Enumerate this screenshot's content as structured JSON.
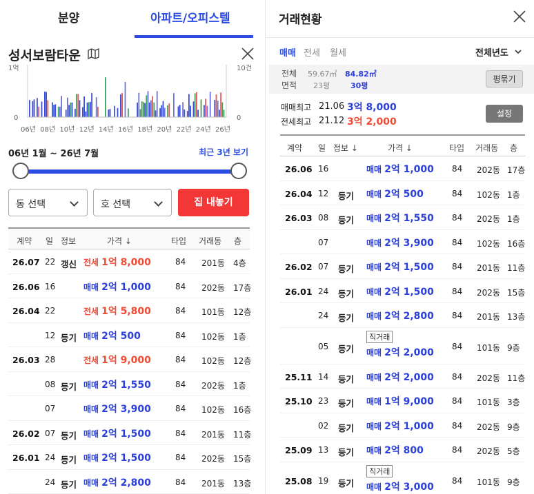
{
  "tabs": [
    {
      "label": "분양"
    },
    {
      "label": "아파트/오피스텔"
    }
  ],
  "apt": {
    "name": "성서보람타운"
  },
  "chart_data": {
    "type": "bar",
    "x_ticks": [
      "06년",
      "08년",
      "10년",
      "12년",
      "14년",
      "16년",
      "18년",
      "20년",
      "22년",
      "24년",
      "26년"
    ],
    "y_left_top": "1억",
    "y_left_bottom": "0",
    "y_right_top": "10건",
    "y_right_bottom": "0"
  },
  "period": {
    "label": "06년 1월 ~ 26년 7월",
    "recent": "최근 3년 보기"
  },
  "filters": {
    "dong": "동 선택",
    "ho": "호 선택",
    "sell": "집 내놓기"
  },
  "left_table": {
    "headers": [
      "계약",
      "일",
      "정보",
      "가격 ↓",
      "타입",
      "거래동",
      "층"
    ],
    "rows": [
      {
        "date": "26.07",
        "day": "22",
        "info": "갱신",
        "kind": "전세",
        "price": "1억 8,000",
        "type": "84",
        "dong": "201동",
        "floor": "4층",
        "rent": true
      },
      {
        "date": "26.06",
        "day": "16",
        "info": "",
        "kind": "매매",
        "price": "2억 1,000",
        "type": "84",
        "dong": "202동",
        "floor": "17층",
        "rent": false
      },
      {
        "date": "26.04",
        "day": "22",
        "info": "",
        "kind": "전세",
        "price": "1억 5,800",
        "type": "84",
        "dong": "101동",
        "floor": "12층",
        "rent": true
      },
      {
        "date": "",
        "day": "12",
        "info": "등기",
        "kind": "매매",
        "price": "2억 500",
        "type": "84",
        "dong": "102동",
        "floor": "1층",
        "rent": false
      },
      {
        "date": "26.03",
        "day": "28",
        "info": "",
        "kind": "전세",
        "price": "1억 9,000",
        "type": "84",
        "dong": "102동",
        "floor": "12층",
        "rent": true
      },
      {
        "date": "",
        "day": "08",
        "info": "등기",
        "kind": "매매",
        "price": "2억 1,550",
        "type": "84",
        "dong": "202동",
        "floor": "1층",
        "rent": false
      },
      {
        "date": "",
        "day": "07",
        "info": "",
        "kind": "매매",
        "price": "2억 3,900",
        "type": "84",
        "dong": "102동",
        "floor": "16층",
        "rent": false
      },
      {
        "date": "26.02",
        "day": "07",
        "info": "등기",
        "kind": "매매",
        "price": "2억 1,500",
        "type": "84",
        "dong": "201동",
        "floor": "11층",
        "rent": false
      },
      {
        "date": "26.01",
        "day": "24",
        "info": "등기",
        "kind": "매매",
        "price": "2억 1,500",
        "type": "84",
        "dong": "202동",
        "floor": "15층",
        "rent": false
      },
      {
        "date": "",
        "day": "24",
        "info": "등기",
        "kind": "매매",
        "price": "2억 2,800",
        "type": "84",
        "dong": "201동",
        "floor": "13층",
        "rent": false
      }
    ]
  },
  "right": {
    "title": "거래현황",
    "subtabs": [
      "매매",
      "전세",
      "월세"
    ],
    "year": "전체년도",
    "area": {
      "label1": "전체",
      "label2": "면적",
      "a1": "59.67㎡",
      "a1p": "23평",
      "a2": "84.82㎡",
      "a2p": "30평",
      "button": "평묶기"
    },
    "max": {
      "buy_label": "매매최고",
      "buy_date": "21.06",
      "buy_price": "3억 8,000",
      "jeon_label": "전세최고",
      "jeon_date": "21.12",
      "jeon_price": "3억 2,000",
      "setting": "설정"
    },
    "headers": [
      "계약",
      "일",
      "정보 ↓",
      "가격 ↓",
      "타입",
      "거래동",
      "층"
    ],
    "rows": [
      {
        "date": "26.06",
        "day": "16",
        "info": "",
        "tag": "",
        "kind": "매매",
        "price": "2억 1,000",
        "type": "84",
        "dong": "202동",
        "floor": "17층"
      },
      {
        "date": "26.04",
        "day": "12",
        "info": "등기",
        "tag": "",
        "kind": "매매",
        "price": "2억 500",
        "type": "84",
        "dong": "102동",
        "floor": "1층"
      },
      {
        "date": "26.03",
        "day": "08",
        "info": "등기",
        "tag": "",
        "kind": "매매",
        "price": "2억 1,550",
        "type": "84",
        "dong": "202동",
        "floor": "1층"
      },
      {
        "date": "",
        "day": "07",
        "info": "",
        "tag": "",
        "kind": "매매",
        "price": "2억 3,900",
        "type": "84",
        "dong": "102동",
        "floor": "16층"
      },
      {
        "date": "26.02",
        "day": "07",
        "info": "등기",
        "tag": "",
        "kind": "매매",
        "price": "2억 1,500",
        "type": "84",
        "dong": "201동",
        "floor": "11층"
      },
      {
        "date": "26.01",
        "day": "24",
        "info": "등기",
        "tag": "",
        "kind": "매매",
        "price": "2억 1,500",
        "type": "84",
        "dong": "202동",
        "floor": "15층"
      },
      {
        "date": "",
        "day": "24",
        "info": "등기",
        "tag": "",
        "kind": "매매",
        "price": "2억 2,800",
        "type": "84",
        "dong": "201동",
        "floor": "13층"
      },
      {
        "date": "",
        "day": "05",
        "info": "등기",
        "tag": "직거래",
        "kind": "매매",
        "price": "2억 2,000",
        "type": "84",
        "dong": "101동",
        "floor": "9층"
      },
      {
        "date": "25.11",
        "day": "14",
        "info": "등기",
        "tag": "",
        "kind": "매매",
        "price": "2억 2,000",
        "type": "84",
        "dong": "202동",
        "floor": "11층"
      },
      {
        "date": "25.10",
        "day": "23",
        "info": "등기",
        "tag": "",
        "kind": "매매",
        "price": "1억 9,000",
        "type": "84",
        "dong": "101동",
        "floor": "3층"
      },
      {
        "date": "",
        "day": "02",
        "info": "등기",
        "tag": "",
        "kind": "매매",
        "price": "2억 1,000",
        "type": "84",
        "dong": "202동",
        "floor": "9층"
      },
      {
        "date": "25.09",
        "day": "13",
        "info": "등기",
        "tag": "",
        "kind": "매매",
        "price": "2억 800",
        "type": "84",
        "dong": "202동",
        "floor": "5층"
      },
      {
        "date": "25.08",
        "day": "19",
        "info": "등기",
        "tag": "직거래",
        "kind": "매매",
        "price": "2억 3,000",
        "type": "84",
        "dong": "101동",
        "floor": "9층"
      }
    ]
  }
}
